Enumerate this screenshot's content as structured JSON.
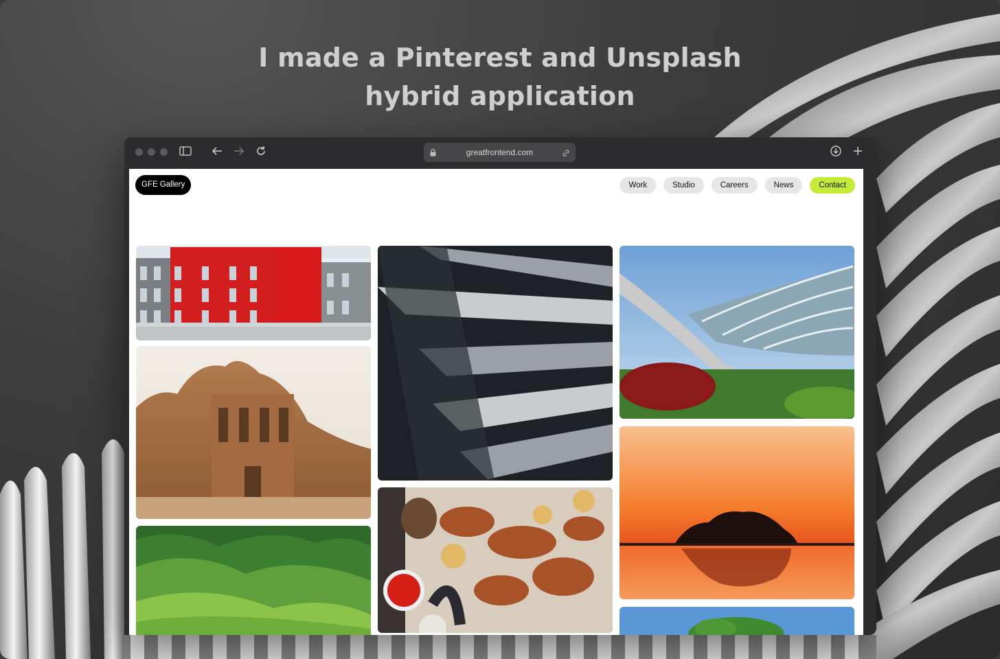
{
  "headline": {
    "line1": "I made a Pinterest and Unsplash",
    "line2": "hybrid application"
  },
  "browser": {
    "url": "greatfrontend.com",
    "icons": [
      "sidebar-icon",
      "back-arrow-icon",
      "forward-arrow-icon",
      "reload-icon",
      "lock-icon",
      "link-icon",
      "download-icon",
      "new-tab-plus-icon"
    ]
  },
  "site": {
    "logo": "GFE Gallery",
    "nav": [
      {
        "label": "Work"
      },
      {
        "label": "Studio"
      },
      {
        "label": "Careers"
      },
      {
        "label": "News"
      },
      {
        "label": "Contact"
      }
    ],
    "accent_color": "#c6ea3a"
  },
  "gallery": {
    "columns": [
      [
        {
          "subject": "red and grey office building"
        },
        {
          "subject": "desert rock-carved monastery"
        },
        {
          "subject": "green rolling hills"
        }
      ],
      [
        {
          "subject": "abstract dark architecture"
        },
        {
          "subject": "grilled kebab platter"
        }
      ],
      [
        {
          "subject": "curved glass greenhouse bridge"
        },
        {
          "subject": "orange sunset island reflection"
        },
        {
          "subject": "tree under blue sky"
        }
      ]
    ]
  }
}
